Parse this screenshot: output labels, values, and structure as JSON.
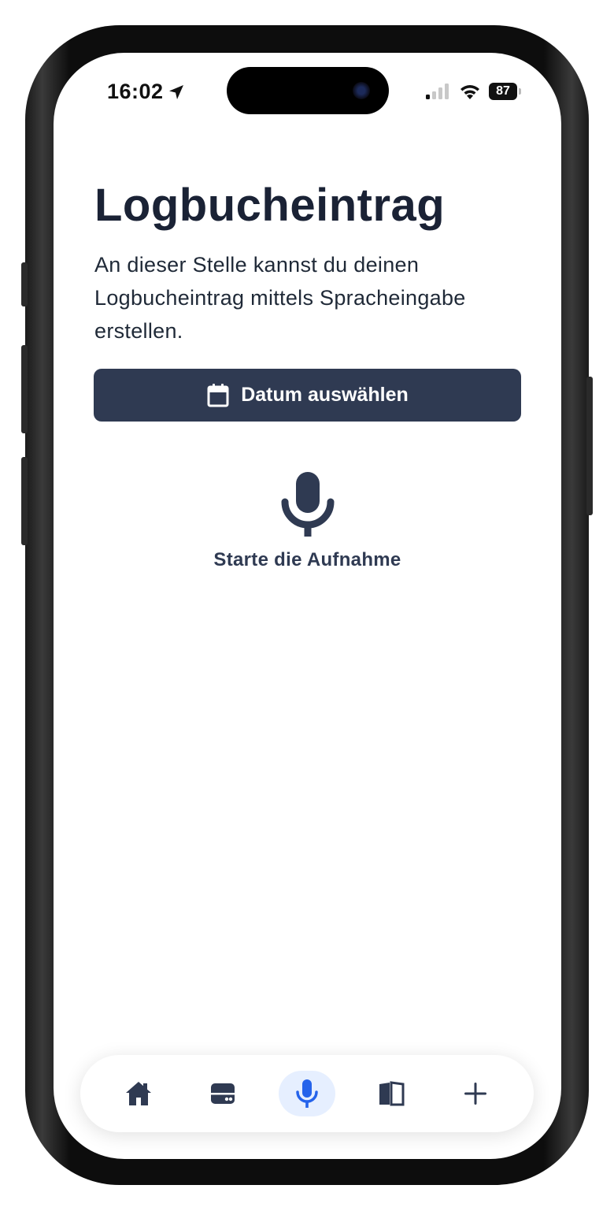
{
  "status_bar": {
    "time": "16:02",
    "battery": "87"
  },
  "page": {
    "title": "Logbucheintrag",
    "description": "An dieser Stelle kannst du deinen Logbucheintrag mittels Spracheingabe erstellen.",
    "date_button_label": "Datum auswählen",
    "record_label": "Starte die Aufnahme"
  },
  "tabbar": {
    "items": [
      {
        "icon": "home-icon",
        "active": false
      },
      {
        "icon": "inbox-icon",
        "active": false
      },
      {
        "icon": "microphone-icon",
        "active": true
      },
      {
        "icon": "book-icon",
        "active": false
      },
      {
        "icon": "plus-icon",
        "active": false
      }
    ]
  },
  "colors": {
    "primary": "#2f3a52",
    "title": "#1a2235",
    "active_tab_bg": "#e6efff",
    "active_tab_icon": "#2563eb"
  }
}
